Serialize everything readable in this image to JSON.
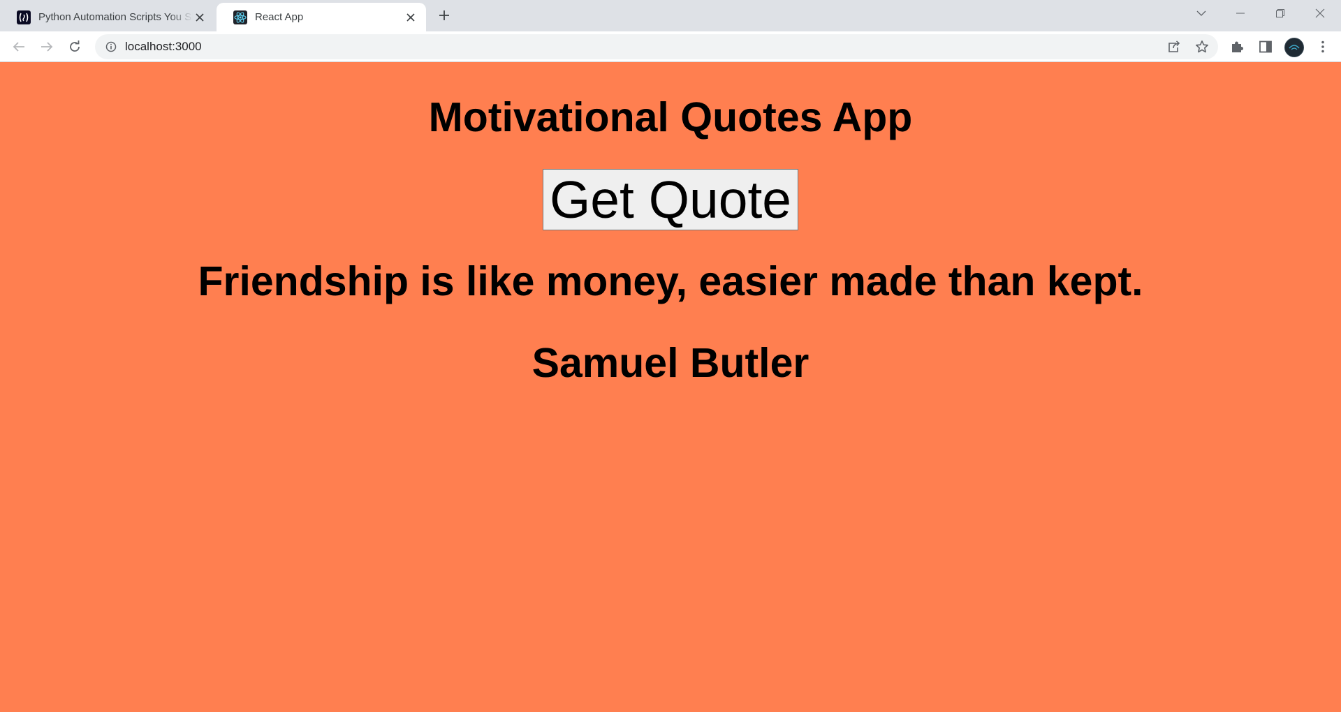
{
  "browser": {
    "tabs": [
      {
        "title": "Python Automation Scripts You Sh",
        "favicon": "freecodecamp-icon"
      },
      {
        "title": "React App",
        "favicon": "react-icon",
        "active": true
      }
    ],
    "address_bar": {
      "url": "localhost:3000"
    },
    "colors": {
      "tabstrip": "#dee1e6",
      "toolbar": "#ffffff",
      "omnibox": "#f1f3f4"
    }
  },
  "page": {
    "title": "Motivational Quotes App",
    "button_label": "Get Quote",
    "quote": "Friendship is like money, easier made than kept.",
    "author": "Samuel Butler",
    "colors": {
      "background": "#ff7f50",
      "text": "#000000",
      "button_bg": "#efefef"
    }
  }
}
